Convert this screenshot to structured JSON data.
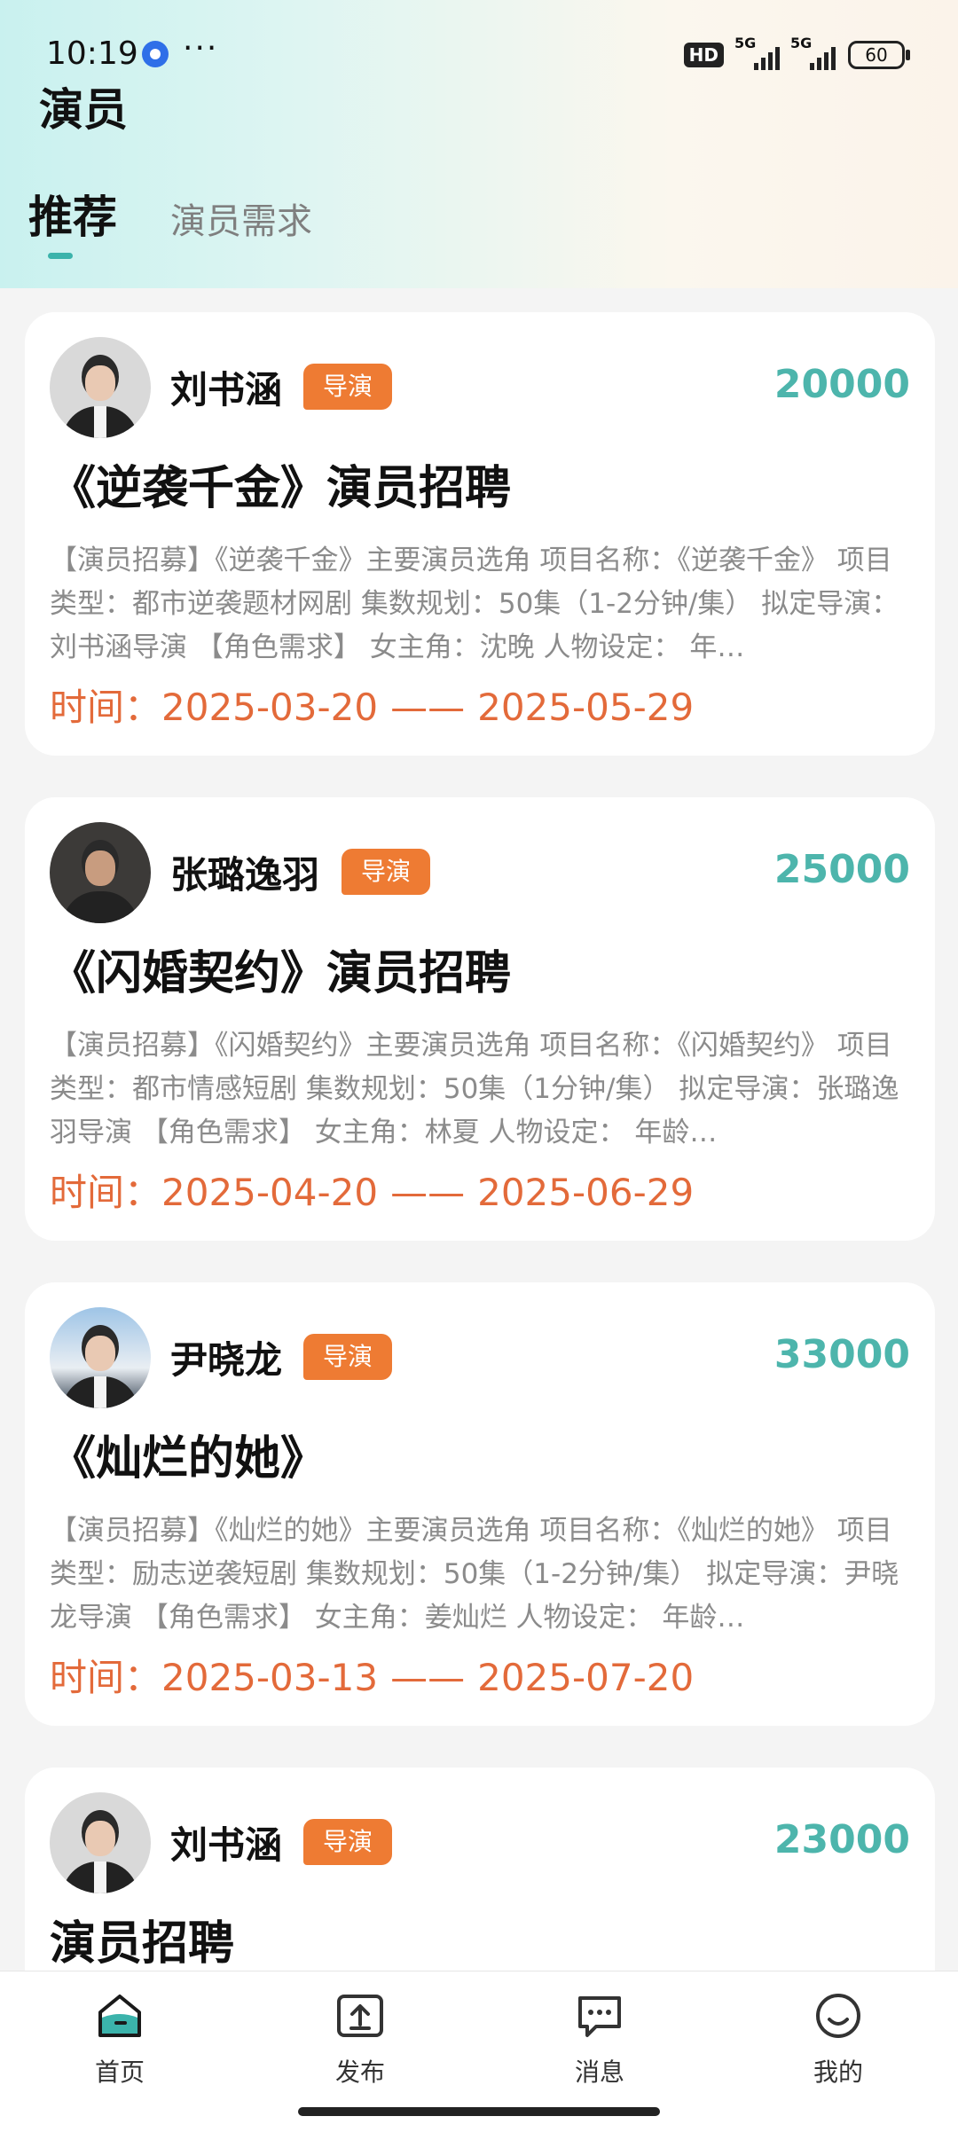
{
  "status_bar": {
    "time": "10:19",
    "more": "···",
    "hd": "HD",
    "network1": "5G",
    "network2": "5G",
    "battery": "60"
  },
  "page": {
    "title": "演员"
  },
  "tabs": [
    {
      "label": "推荐",
      "active": true
    },
    {
      "label": "演员需求",
      "active": false
    }
  ],
  "posts": [
    {
      "author": "刘书涵",
      "role": "导演",
      "price": "20000",
      "title": "《逆袭千金》演员招聘",
      "description": "【演员招募】《逆袭千金》主要演员选角 项目名称：《逆袭千金》 项目类型：都市逆袭题材网剧 集数规划：50集（1-2分钟/集） 拟定导演：刘书涵导演 【角色需求】 女主角：沈晚 人物设定： 年…",
      "time_label": "时间：",
      "start": "2025-03-20",
      "sep": "——",
      "end": "2025-05-29"
    },
    {
      "author": "张璐逸羽",
      "role": "导演",
      "price": "25000",
      "title": "《闪婚契约》演员招聘",
      "description": "【演员招募】《闪婚契约》主要演员选角 项目名称：《闪婚契约》 项目类型：都市情感短剧 集数规划：50集（1分钟/集） 拟定导演：张璐逸羽导演 【角色需求】 女主角：林夏 人物设定： 年龄…",
      "time_label": "时间：",
      "start": "2025-04-20",
      "sep": "——",
      "end": "2025-06-29"
    },
    {
      "author": "尹晓龙",
      "role": "导演",
      "price": "33000",
      "title": "《灿烂的她》",
      "description": "【演员招募】《灿烂的她》主要演员选角 项目名称：《灿烂的她》 项目类型：励志逆袭短剧 集数规划：50集（1-2分钟/集） 拟定导演：尹晓龙导演 【角色需求】 女主角：姜灿烂 人物设定： 年龄…",
      "time_label": "时间：",
      "start": "2025-03-13",
      "sep": "——",
      "end": "2025-07-20"
    },
    {
      "author": "刘书涵",
      "role": "导演",
      "price": "23000",
      "title": "演员招聘"
    }
  ],
  "bottom_nav": [
    {
      "label": "首页",
      "icon": "home-icon",
      "active": true
    },
    {
      "label": "发布",
      "icon": "upload-icon",
      "active": false
    },
    {
      "label": "消息",
      "icon": "message-icon",
      "active": false
    },
    {
      "label": "我的",
      "icon": "profile-icon",
      "active": false
    }
  ],
  "colors": {
    "accent": "#4db5ac",
    "tag": "#ee7b33",
    "time": "#e36a3a"
  }
}
